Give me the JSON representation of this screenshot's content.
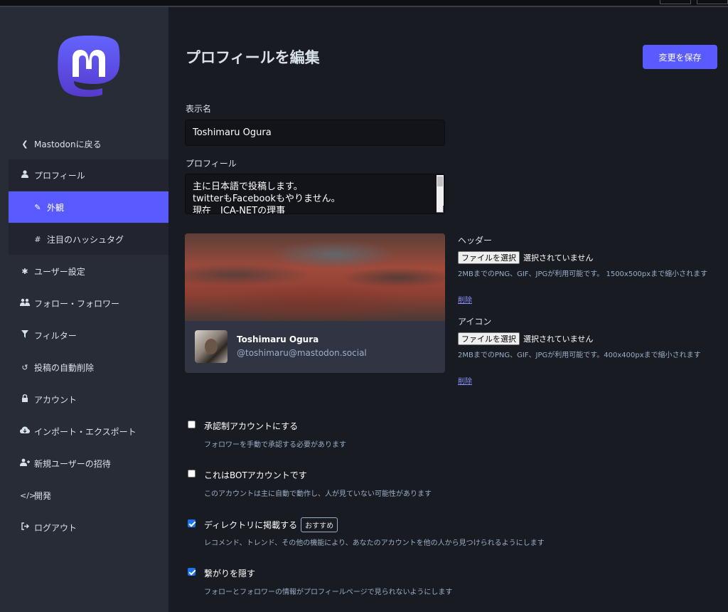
{
  "sidebar": {
    "back": "Mastodonに戻る",
    "profile": "プロフィール",
    "appearance": "外観",
    "hashtags": "注目のハッシュタグ",
    "user_settings": "ユーザー設定",
    "follows": "フォロー・フォロワー",
    "filters": "フィルター",
    "auto_delete": "投稿の自動削除",
    "account": "アカウント",
    "import_export": "インポート・エクスポート",
    "invites": "新規ユーザーの招待",
    "development": "開発",
    "logout": "ログアウト"
  },
  "main": {
    "title": "プロフィールを編集",
    "save_label": "変更を保存",
    "display_name_label": "表示名",
    "display_name_value": "Toshimaru Ogura",
    "bio_label": "プロフィール",
    "bio_lines": [
      "主に日本語で投稿します。",
      "twitterもFacebookもやりません。",
      "現在　JCA-NETの理事"
    ]
  },
  "card": {
    "name": "Toshimaru Ogura",
    "handle": "@toshimaru@mastodon.social"
  },
  "header_upload": {
    "label": "ヘッダー",
    "button": "ファイルを選択",
    "status": "選択されていません",
    "hint": "2MBまでのPNG、GIF、JPGが利用可能です。 1500x500pxまで縮小されます",
    "delete": "削除"
  },
  "avatar_upload": {
    "label": "アイコン",
    "button": "ファイルを選択",
    "status": "選択されていません",
    "hint": "2MBまでのPNG、GIF、JPGが利用可能です。400x400pxまで縮小されます",
    "delete": "削除"
  },
  "options": {
    "locked": {
      "label": "承認制アカウントにする",
      "hint": "フォロワーを手動で承認する必要があります",
      "checked": false
    },
    "bot": {
      "label": "これはBOTアカウントです",
      "hint": "このアカウントは主に自動で動作し、人が見ていない可能性があります",
      "checked": false
    },
    "discoverable": {
      "label": "ディレクトリに掲載する",
      "badge": "おすすめ",
      "hint": "レコメンド、トレンド、その他の機能により、あなたのアカウントを他の人から見つけられるようにします",
      "checked": true
    },
    "hide_network": {
      "label": "繋がりを隠す",
      "hint": "フォローとフォロワーの情報がプロフィールページで見られないようにします",
      "checked": true
    }
  },
  "colors": {
    "accent": "#595aff",
    "sidebar_bg": "#282c37",
    "main_bg": "#191b22",
    "input_bg": "#131419",
    "hint_text": "#9baec8"
  },
  "icons": {
    "back": "chevron-left-icon",
    "profile": "user-icon",
    "appearance": "pencil-icon",
    "hashtags": "hashtag-icon",
    "user_settings": "gear-icon",
    "follows": "users-icon",
    "filters": "filter-icon",
    "auto_delete": "history-icon",
    "account": "lock-icon",
    "import_export": "cloud-download-icon",
    "invites": "user-plus-icon",
    "development": "code-icon",
    "logout": "sign-out-icon"
  }
}
